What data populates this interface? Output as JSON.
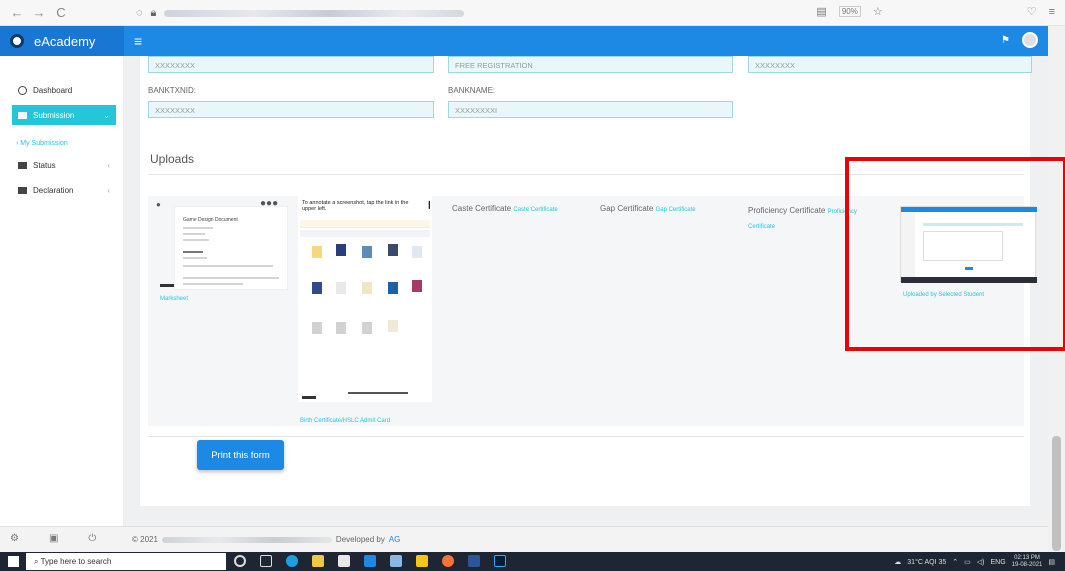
{
  "browser": {
    "back": "←",
    "forward": "→",
    "reload": "C",
    "zoom": "90%"
  },
  "header": {
    "app_name": "eAcademy"
  },
  "sidebar": {
    "items": [
      {
        "label": "Dashboard"
      },
      {
        "label": "Submission"
      },
      {
        "label": "› My Submission"
      },
      {
        "label": "Status"
      },
      {
        "label": "Declaration"
      }
    ]
  },
  "form": {
    "top_fields": [
      "XXXXXXXX",
      "FREE REGISTRATION",
      "XXXXXXXX"
    ],
    "banktxnid_label": "BANKTXNID:",
    "banktxnid_value": "XXXXXXXX",
    "bankname_label": "BANKNAME:",
    "bankname_value": "XXXXXXXXI"
  },
  "uploads": {
    "title": "Uploads",
    "marksheet_link": "Marksheet",
    "birth_link": "Birth Certificate/HSLC Admit Card",
    "caste_label": "Caste Certificate",
    "caste_link": "Caste Certificate",
    "gap_label": "Gap Certificate",
    "gap_link": "Gap Certificate",
    "proficiency_label": "Proficiency Certificate",
    "proficiency_link_1": "Proficiency",
    "proficiency_link_2": "Certificate",
    "selected_student_link": "Uploaded by Selected Student",
    "phone_text": "To annotate a screenshot, tap the link in the upper left.",
    "doc_title": "Game Design Document"
  },
  "print_button": "Print this form",
  "footer": {
    "copyright": "© 2021",
    "developed": "Developed by",
    "dev_link": "AG"
  },
  "taskbar": {
    "search_placeholder": "Type here to search",
    "weather": "31°C AQI 35",
    "lang": "ENG",
    "time": "02:13 PM",
    "date": "19-08-2021"
  }
}
